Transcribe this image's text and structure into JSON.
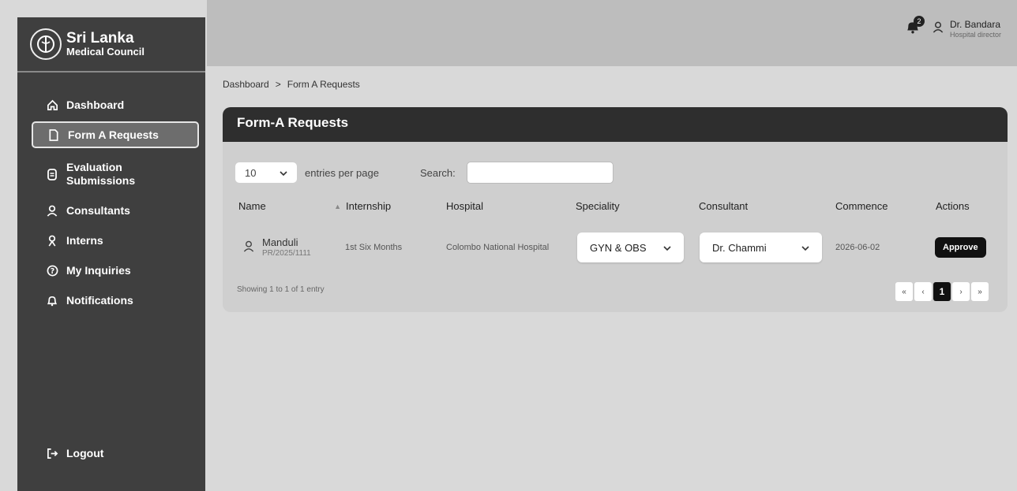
{
  "app": {
    "logo_line1": "Sri Lanka",
    "logo_line2": "Medical Council"
  },
  "sidebar": {
    "items": [
      {
        "label": "Dashboard",
        "icon": "home-icon"
      },
      {
        "label": "Form A Requests",
        "icon": "document-icon",
        "active": true
      },
      {
        "label": "Evaluation Submissions",
        "icon": "clipboard-icon"
      },
      {
        "label": "Consultants",
        "icon": "user-icon"
      },
      {
        "label": "Interns",
        "icon": "intern-icon"
      },
      {
        "label": "My Inquiries",
        "icon": "question-icon"
      },
      {
        "label": "Notifications",
        "icon": "bell-icon"
      }
    ],
    "logout_label": "Logout"
  },
  "header": {
    "notification_count": "2",
    "user_name": "Dr. Bandara",
    "user_role": "Hospital director"
  },
  "breadcrumb": {
    "items": [
      "Dashboard",
      "Form A Requests"
    ],
    "separator": ">"
  },
  "card": {
    "title": "Form-A Requests",
    "per_page_value": "10",
    "per_page_label": "entries per page",
    "search_label": "Search:",
    "search_value": ""
  },
  "table": {
    "columns": [
      "Name",
      "Internship",
      "Hospital",
      "Speciality",
      "Consultant",
      "Commence",
      "Actions"
    ],
    "rows": [
      {
        "name": "Manduli",
        "reg_no": "PR/2025/1111",
        "internship": "1st Six Months",
        "hospital": "Colombo National Hospital",
        "speciality": "GYN & OBS",
        "consultant": "Dr. Chammi",
        "commence": "2026-06-02",
        "action": "Approve"
      }
    ],
    "footer_info": "Showing 1 to 1 of 1 entry"
  },
  "pagination": {
    "first": "«",
    "prev": "‹",
    "current": "1",
    "next": "›",
    "last": "»"
  },
  "colors": {
    "sidebar_bg": "#3f3f3f",
    "header_bar": "#2e2e2e",
    "accent_button": "#111111"
  }
}
